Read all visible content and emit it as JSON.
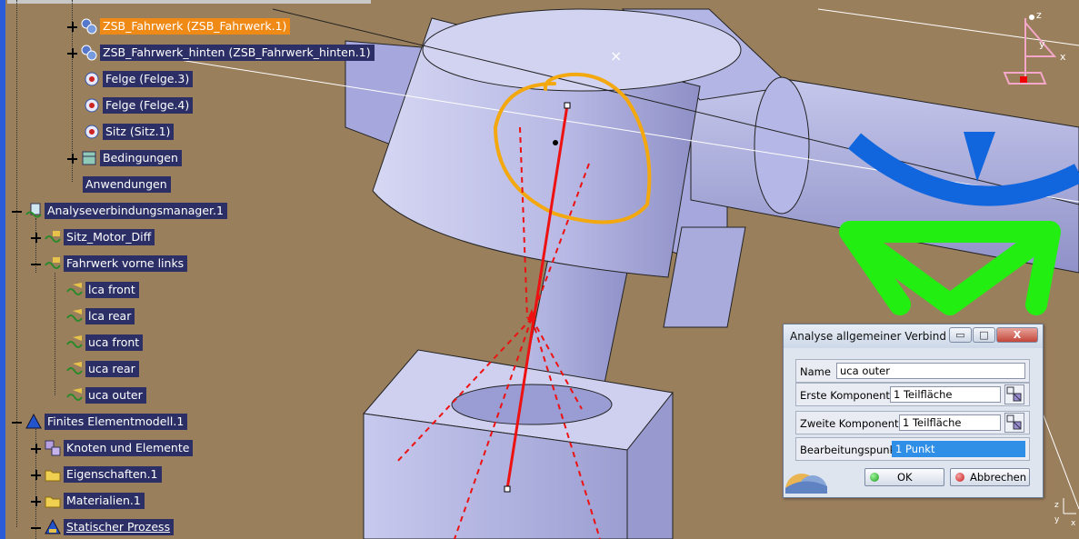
{
  "tree": [
    {
      "label": "ZSB_Fahrwerk (ZSB_Fahrwerk.1)",
      "toggle": "plus",
      "icon": "product-gear-icon",
      "selected": true
    },
    {
      "label": "ZSB_Fahrwerk_hinten (ZSB_Fahrwerk_hinten.1)",
      "toggle": "plus",
      "icon": "product-gear-icon"
    },
    {
      "label": "Felge (Felge.3)",
      "toggle": "none",
      "icon": "part-gear-icon"
    },
    {
      "label": "Felge (Felge.4)",
      "toggle": "none",
      "icon": "part-gear-icon"
    },
    {
      "label": "Sitz (Sitz.1)",
      "toggle": "none",
      "icon": "part-gear-icon"
    },
    {
      "label": "Bedingungen",
      "toggle": "plus",
      "icon": "constraints-icon"
    },
    {
      "label": "Anwendungen",
      "toggle": "none",
      "icon": ""
    },
    {
      "label": "Analyseverbindungsmanager.1",
      "toggle": "minus",
      "icon": "connection-manager-icon"
    },
    {
      "label": "Sitz_Motor_Diff",
      "toggle": "plus",
      "icon": "connection-set-icon"
    },
    {
      "label": "Fahrwerk vorne links",
      "toggle": "minus",
      "icon": "connection-set-icon"
    },
    {
      "label": "lca front",
      "toggle": "none",
      "icon": "connection-icon"
    },
    {
      "label": "lca rear",
      "toggle": "none",
      "icon": "connection-icon"
    },
    {
      "label": "uca front",
      "toggle": "none",
      "icon": "connection-icon"
    },
    {
      "label": "uca rear",
      "toggle": "none",
      "icon": "connection-icon"
    },
    {
      "label": "uca outer",
      "toggle": "none",
      "icon": "connection-icon"
    },
    {
      "label": "Finites Elementmodell.1",
      "toggle": "minus",
      "icon": "fem-model-icon"
    },
    {
      "label": "Knoten und Elemente",
      "toggle": "plus",
      "icon": "nodes-elements-icon"
    },
    {
      "label": "Eigenschaften.1",
      "toggle": "plus",
      "icon": "properties-folder-icon"
    },
    {
      "label": "Materialien.1",
      "toggle": "plus",
      "icon": "materials-folder-icon"
    },
    {
      "label": "Statischer Prozess",
      "toggle": "minus",
      "icon": "static-process-icon",
      "underline": true
    }
  ],
  "dialog": {
    "title": "Analyse allgemeiner Verbindu...",
    "minimize": "▭",
    "maximize": "□",
    "close": "X",
    "name_label": "Name",
    "name_value": "uca outer",
    "first_label": "Erste Komponente",
    "first_value": "1 Teilfläche",
    "second_label": "Zweite Komponente",
    "second_value": "1 Teilfläche",
    "point_label": "Bearbeitungspunkt",
    "point_value": "1 Punkt",
    "ok": "OK",
    "cancel": "Abbrechen"
  },
  "compass": {
    "z": "z",
    "y": "y",
    "x": "x"
  },
  "triad": {
    "z": "z",
    "y": "y",
    "x": "x"
  },
  "colors": {
    "background": "#9a7f5c",
    "tree_label_bg": "#2b2f66",
    "selected_bg": "#f08a17",
    "part_color": "#b9bbe6",
    "annotation": "#f2a80e",
    "point_line": "#ee1111",
    "compass_blue": "#1166dd",
    "compass_green": "#22ee11"
  }
}
